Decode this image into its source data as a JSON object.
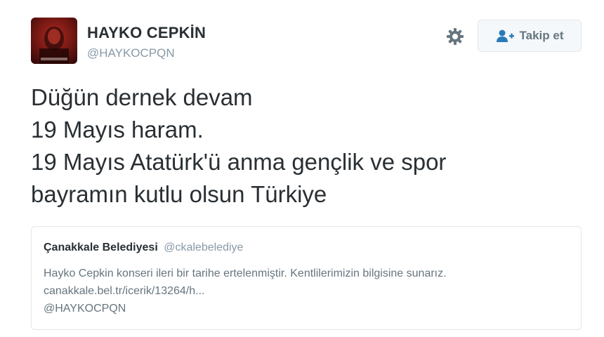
{
  "author": {
    "display_name": "HAYKO CEPKİN",
    "screen_name": "@HAYKOCPQN",
    "avatar_icon": "profile-photo"
  },
  "actions": {
    "settings_icon": "gear-icon",
    "follow_label": "Takip et",
    "follow_icon": "add-user-icon"
  },
  "tweet": {
    "lines": [
      "Düğün dernek devam",
      "19 Mayıs haram.",
      "19 Mayıs Atatürk'ü anma gençlik ve spor",
      "bayramın kutlu olsun Türkiye"
    ]
  },
  "quoted_tweet": {
    "name": "Çanakkale Belediyesi",
    "handle": "@ckalebelediye",
    "lines": [
      "Hayko Cepkin konseri ileri bir tarihe ertelenmiştir. Kentlilerimizin bilgisine sunarız.",
      "canakkale.bel.tr/icerik/13264/h...",
      "@HAYKOCPQN"
    ]
  },
  "colors": {
    "text_primary": "#292f33",
    "text_secondary": "#8899a6",
    "text_quote": "#66757f",
    "border": "#e1e8ed",
    "button_bg": "#f5f8fa"
  }
}
